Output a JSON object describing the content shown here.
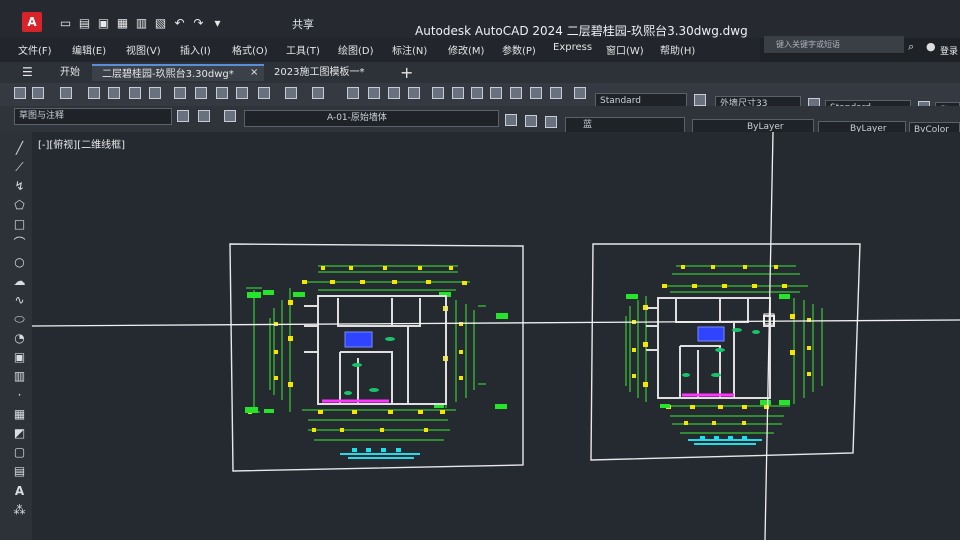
{
  "app": {
    "logo_letter": "A",
    "title": "Autodesk AutoCAD 2024   二层碧桂园-玖熙台3.30dwg.dwg",
    "share_label": "共享",
    "search_placeholder": "键入关键字或短语",
    "login_label": "登录"
  },
  "menu": [
    "文件(F)",
    "编辑(E)",
    "视图(V)",
    "插入(I)",
    "格式(O)",
    "工具(T)",
    "绘图(D)",
    "标注(N)",
    "修改(M)",
    "参数(P)",
    "Express",
    "窗口(W)",
    "帮助(H)"
  ],
  "tabs": {
    "start": "开始",
    "active": "二层碧桂园-玖熙台3.30dwg*",
    "template": "2023施工图模板一*",
    "add": "+"
  },
  "ribbon": {
    "workspace": "草图与注释",
    "layer": "A-01-原始墙体",
    "color": "蓝",
    "text_style": "Standard",
    "dim_style": "外墙尺寸33",
    "table_style": "Standard",
    "table_style_2": "Star",
    "linetype": "ByLayer",
    "lineweight": "ByLayer",
    "plot_style": "ByColor"
  },
  "viewport": {
    "label": "[-][俯视][二维线框]"
  },
  "colors": {
    "accent": "#5a8fd8",
    "logo": "#d8232a",
    "green": "#35e02e",
    "yellow": "#f2e500",
    "blue": "#2f44ff",
    "cyan": "#20d8e6",
    "magenta": "#ff35ff"
  }
}
